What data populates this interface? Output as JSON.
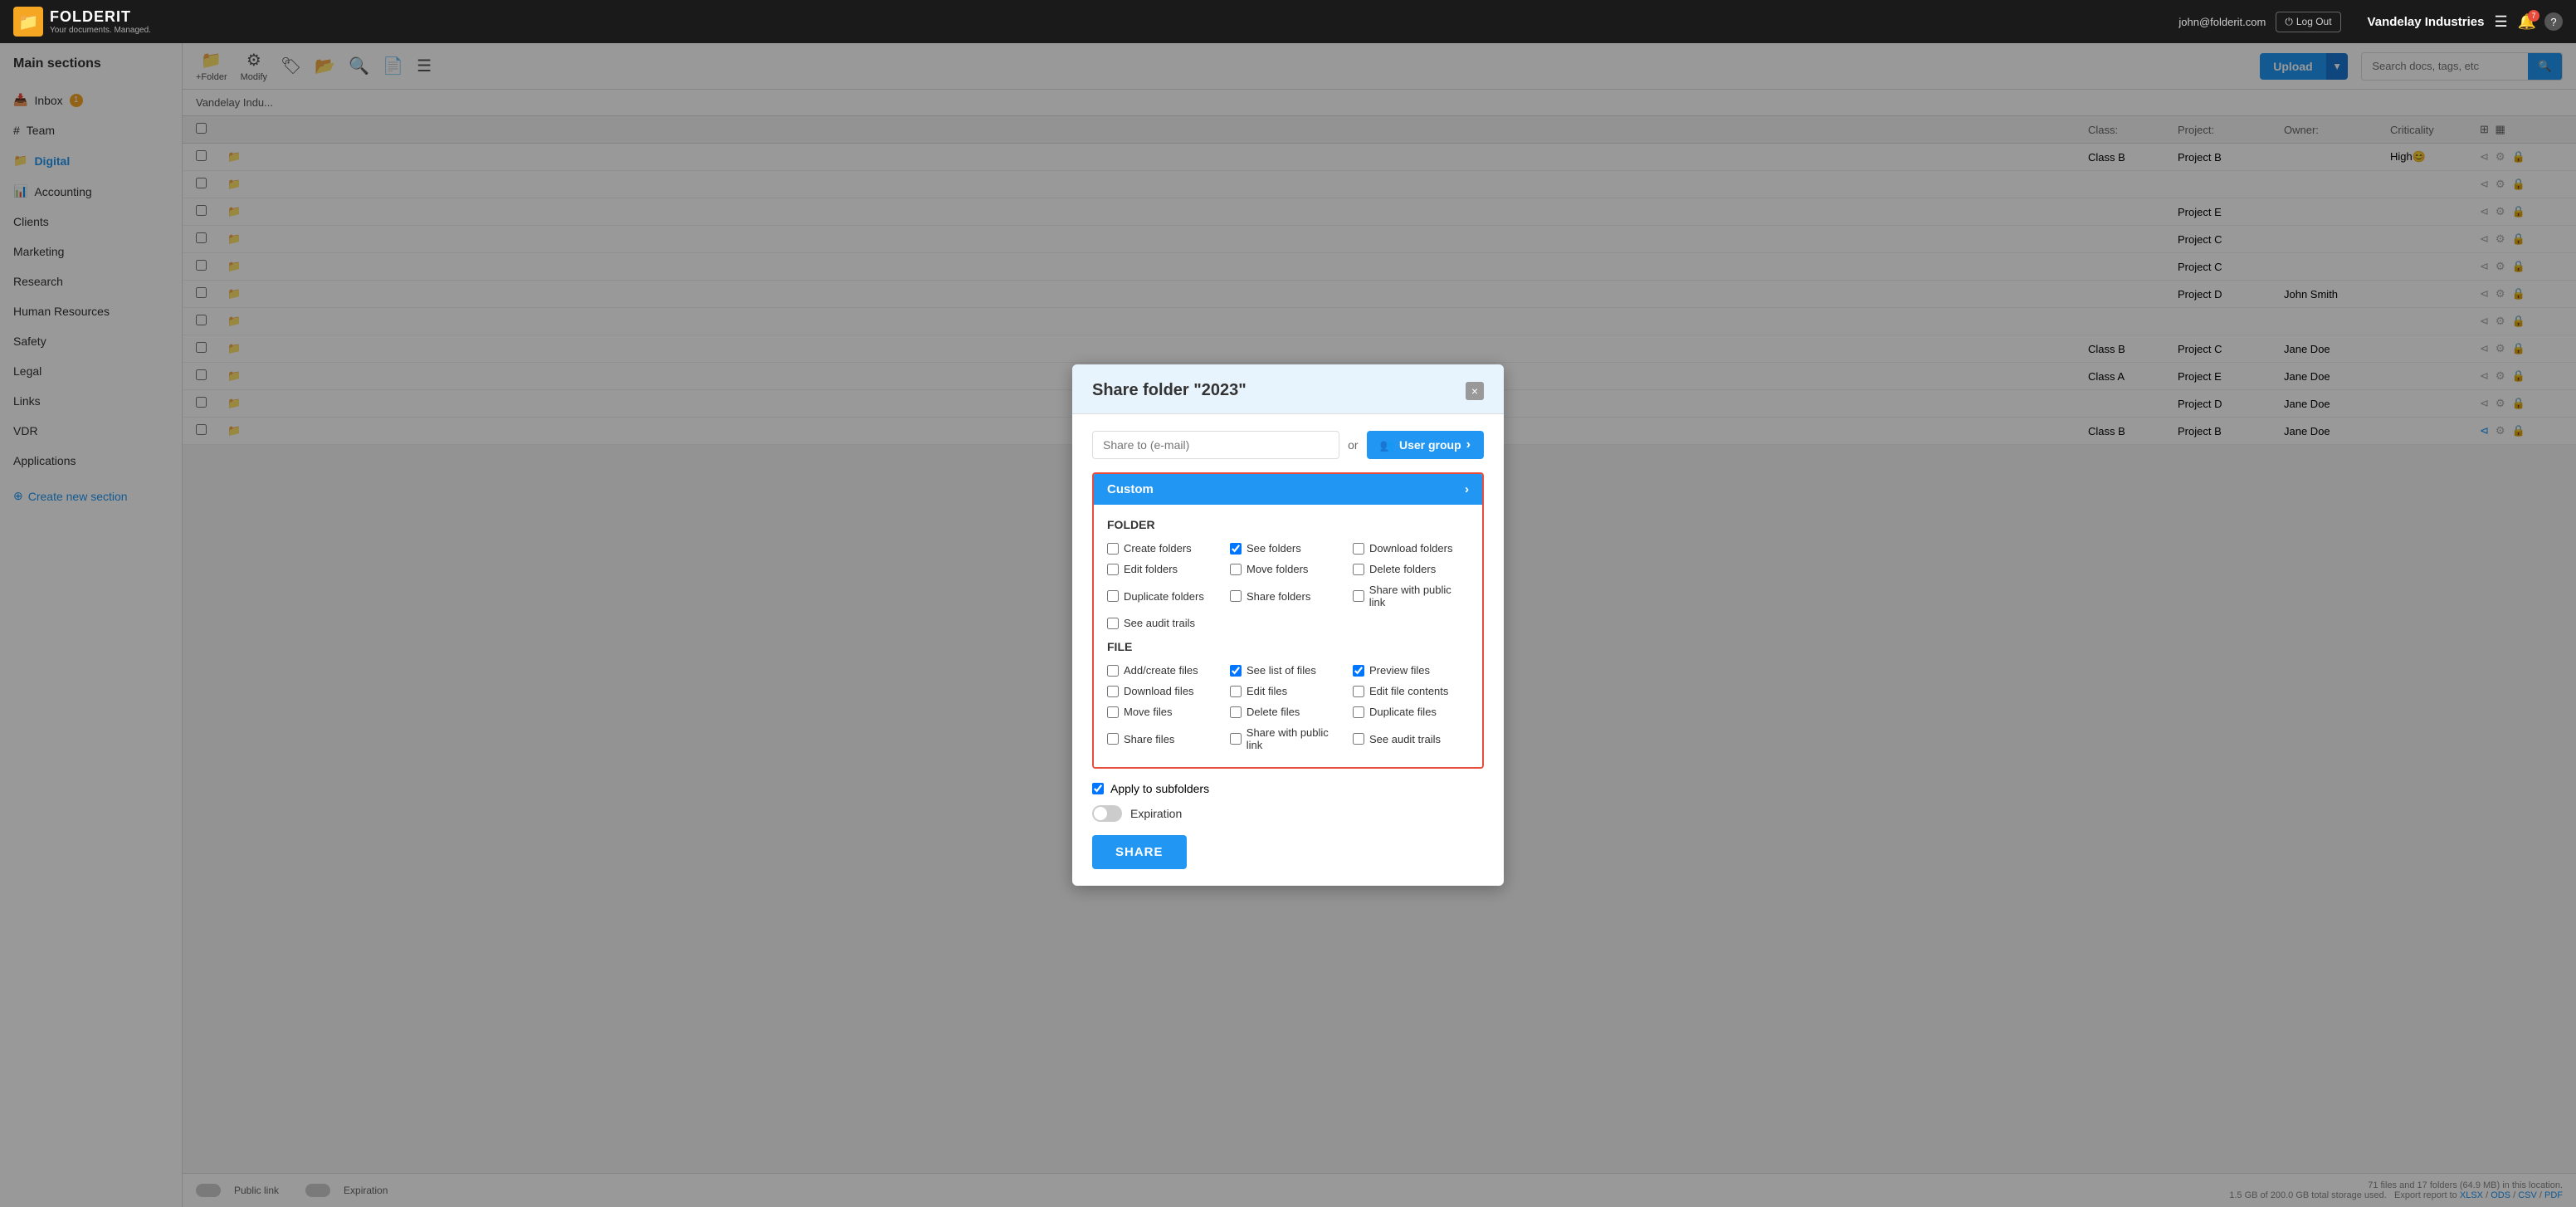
{
  "topbar": {
    "logo_text": "FOLDERIT",
    "logo_sub": "Your documents. Managed.",
    "user_email": "john@folderit.com",
    "logout_label": "Log Out",
    "company_name": "Vandelay Industries",
    "notification_count": "7"
  },
  "sidebar": {
    "title": "Main sections",
    "items": [
      {
        "label": "Inbox",
        "badge": "1",
        "active": false
      },
      {
        "label": "#Team",
        "badge": "",
        "active": false
      },
      {
        "label": "Digital",
        "badge": "",
        "active": true
      },
      {
        "label": "Accounting",
        "badge": "",
        "active": false
      },
      {
        "label": "Clients",
        "badge": "",
        "active": false
      },
      {
        "label": "Marketing",
        "badge": "",
        "active": false
      },
      {
        "label": "Research",
        "badge": "",
        "active": false
      },
      {
        "label": "Human Resources",
        "badge": "",
        "active": false
      },
      {
        "label": "Safety",
        "badge": "",
        "active": false
      },
      {
        "label": "Legal",
        "badge": "",
        "active": false
      },
      {
        "label": "Links",
        "badge": "",
        "active": false
      },
      {
        "label": "VDR",
        "badge": "",
        "active": false
      },
      {
        "label": "Applications",
        "badge": "",
        "active": false
      }
    ],
    "create_label": "Create new section"
  },
  "toolbar": {
    "add_folder_label": "+Folder",
    "modify_label": "Modify",
    "upload_label": "Upload",
    "search_placeholder": "Search docs, tags, etc"
  },
  "breadcrumb": {
    "path": "Vandelay Indu..."
  },
  "table": {
    "headers": {
      "class": "Class:",
      "project": "Project:",
      "owner": "Owner:",
      "criticality": "Criticality"
    },
    "rows": [
      {
        "class": "Class B",
        "project": "Project B",
        "owner": "",
        "criticality": "High"
      },
      {
        "class": "",
        "project": "",
        "owner": "",
        "criticality": ""
      },
      {
        "class": "",
        "project": "Project E",
        "owner": "",
        "criticality": ""
      },
      {
        "class": "",
        "project": "Project C",
        "owner": "",
        "criticality": ""
      },
      {
        "class": "",
        "project": "Project C",
        "owner": "",
        "criticality": ""
      },
      {
        "class": "",
        "project": "Project D",
        "owner": "John Smith",
        "criticality": ""
      },
      {
        "class": "",
        "project": "",
        "owner": "",
        "criticality": ""
      },
      {
        "class": "Class B",
        "project": "Project C",
        "owner": "Jane Doe",
        "criticality": ""
      },
      {
        "class": "Class A",
        "project": "Project E",
        "owner": "Jane Doe",
        "criticality": ""
      },
      {
        "class": "",
        "project": "Project D",
        "owner": "Jane Doe",
        "criticality": ""
      },
      {
        "class": "Class B",
        "project": "Project B",
        "owner": "Jane Doe",
        "criticality": ""
      }
    ]
  },
  "modal": {
    "title": "Share folder \"2023\"",
    "close_label": "×",
    "share_email_placeholder": "Share to (e-mail)",
    "or_label": "or",
    "user_group_label": "User group",
    "custom_label": "Custom",
    "folder_section": "FOLDER",
    "folder_perms": [
      {
        "label": "Create folders",
        "checked": false
      },
      {
        "label": "See folders",
        "checked": true
      },
      {
        "label": "Download folders",
        "checked": false
      },
      {
        "label": "Edit folders",
        "checked": false
      },
      {
        "label": "Move folders",
        "checked": false
      },
      {
        "label": "Delete folders",
        "checked": false
      },
      {
        "label": "Duplicate folders",
        "checked": false
      },
      {
        "label": "Share folders",
        "checked": false
      },
      {
        "label": "Share with public link",
        "checked": false
      },
      {
        "label": "See audit trails",
        "checked": false
      }
    ],
    "file_section": "FILE",
    "file_perms": [
      {
        "label": "Add/create files",
        "checked": false
      },
      {
        "label": "See list of files",
        "checked": true
      },
      {
        "label": "Preview files",
        "checked": true
      },
      {
        "label": "Download files",
        "checked": false
      },
      {
        "label": "Edit files",
        "checked": false
      },
      {
        "label": "Edit file contents",
        "checked": false
      },
      {
        "label": "Move files",
        "checked": false
      },
      {
        "label": "Delete files",
        "checked": false
      },
      {
        "label": "Duplicate files",
        "checked": false
      },
      {
        "label": "Share files",
        "checked": false
      },
      {
        "label": "Share with public link",
        "checked": false
      },
      {
        "label": "See audit trails",
        "checked": false
      }
    ],
    "apply_subfolders_label": "Apply to subfolders",
    "apply_subfolders_checked": true,
    "expiration_label": "Expiration",
    "share_btn_label": "SHARE"
  },
  "bottom": {
    "public_link_label": "Public link",
    "expiration_label": "Expiration",
    "status_info": "71 files and 17 folders (64.9 MB) in this location.",
    "storage_info": "1.5 GB of 200.0 GB total storage used.",
    "export_label": "Export report to",
    "export_formats": [
      "XLSX",
      "ODS",
      "CSV",
      "PDF"
    ]
  }
}
